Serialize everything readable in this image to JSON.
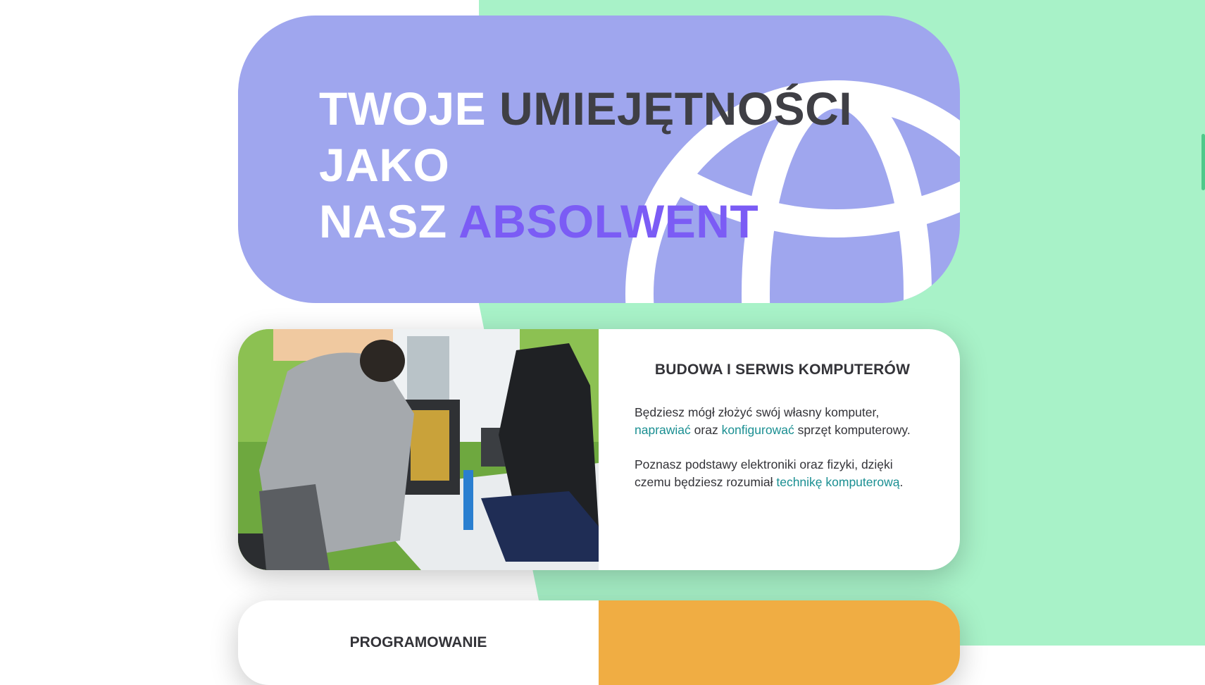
{
  "colors": {
    "page_bg": "#ffffff",
    "mint_bg": "#a8f2c8",
    "hero_bg": "#9fa6ee",
    "hero_white": "#ffffff",
    "hero_dark": "#3f3f45",
    "hero_violet": "#7b5cf5",
    "link_teal": "#1a8f92",
    "text_dark": "#333338",
    "scrollbar": "#4fc98a"
  },
  "hero": {
    "line1_white": "TWOJE",
    "line1_dark": "UMIEJĘTNOŚCI",
    "line2_white": "JAKO",
    "line3_white": "NASZ",
    "line3_violet": "ABSOLWENT",
    "decoration_icon": "globe-icon"
  },
  "card1": {
    "heading": "BUDOWA I SERWIS KOMPUTERÓW",
    "p1_before": "Będziesz mógł złożyć swój własny komputer,",
    "p1_link1": "naprawiać",
    "p1_mid": "oraz",
    "p1_link2": "konfigurować",
    "p1_after": "sprzęt komputerowy.",
    "p2_before": "Poznasz podstawy elektroniki oraz fizyki, dzięki czemu będziesz rozumiał",
    "p2_link": "technikę komputerową",
    "p2_after": "."
  },
  "card2": {
    "heading": "PROGRAMOWANIE"
  }
}
